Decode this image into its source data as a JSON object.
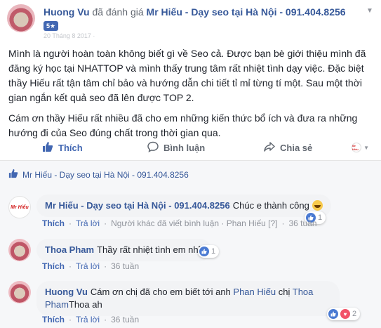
{
  "post": {
    "author": "Huong Vu",
    "verb": "đã đánh giá",
    "page": "Mr Hiếu - Dạy seo tại Hà Nội - 091.404.8256",
    "rating_badge": "5★",
    "date": "20 Tháng 8 2017 · ",
    "paragraphs": [
      "Mình là người hoàn toàn không biết gì về Seo cả. Được bạn bè giới thiệu mình đã đăng ký học tại NHATTOP và mình thấy trung tâm rất nhiệt tình dạy việc. Đặc biệt thầy Hiếu rất tận tâm chỉ bảo và hướng dẫn chi tiết tỉ mỉ từng tí một. Sau một thời gian ngắn kết quả seo đã lên được TOP 2.",
      "Cám ơn thầy Hiếu rất nhiều đã cho em những kiến thức bổ ích và đưa ra những hướng đi của Seo đúng chất trong thời gian qua."
    ]
  },
  "actions": {
    "like": "Thích",
    "comment": "Bình luận",
    "share": "Chia sẻ",
    "logo_text": "Mr Hiếu"
  },
  "liked_by": "Mr Hiếu - Dạy seo tại Hà Nội - 091.404.8256",
  "comments": [
    {
      "author": "Mr Hiếu - Dạy seo tại Hà Nội - 091.404.8256",
      "text": "Chúc e thành công",
      "like": "Thích",
      "reply": "Trả lời",
      "by": "Người khác đã viết bình luận · Phan Hiếu [?]",
      "time": "36 tuần",
      "reactions": "1"
    },
    {
      "author": "Thoa Pham",
      "text": "Thầy rất nhiệt tình em nhỉ!",
      "like": "Thích",
      "reply": "Trả lời",
      "time": "36 tuần",
      "reactions": "1"
    },
    {
      "author": "Huong Vu",
      "text_before": "Cám ơn chị đã cho em biết tới anh",
      "tag1": "Phan Hiếu",
      "text_mid": "chị",
      "tag2": "Thoa Pham",
      "text_after": "Thoa ah",
      "like": "Thích",
      "reply": "Trả lời",
      "time": "36 tuần",
      "reactions": "2"
    }
  ],
  "colors": {
    "link": "#365899",
    "accent": "#4267b2",
    "muted": "#616770",
    "bubble": "#f2f3f5"
  }
}
